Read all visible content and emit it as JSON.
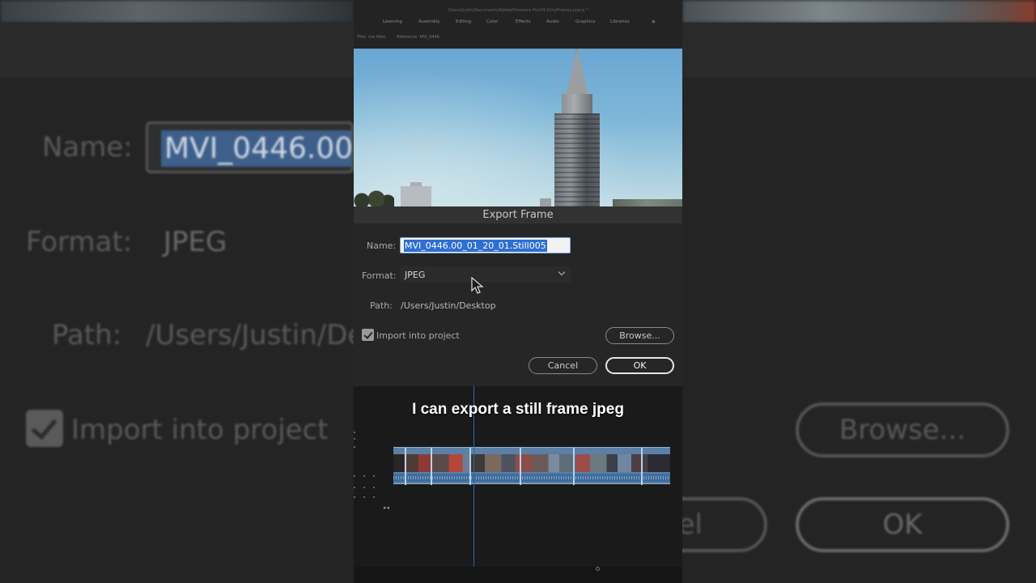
{
  "app": {
    "file_path": "/Users/Justin/Documents/Adobe/Premiere Pro/24.0/myFrames.prproj *",
    "workspaces": [
      "Learning",
      "Assembly",
      "Editing",
      "Color",
      "Effects",
      "Audio",
      "Graphics",
      "Libraries"
    ],
    "more_icon": "double-chevron-right-icon",
    "more_glyph": "»",
    "monitor_title": "Title: (no title)",
    "monitor_reference": "Reference: MVI_0446"
  },
  "dialog": {
    "title": "Export Frame",
    "name_label": "Name:",
    "name_value": "MVI_0446.00_01_20_01.Still005",
    "format_label": "Format:",
    "format_value": "JPEG",
    "path_label": "Path:",
    "path_value": "/Users/Justin/Desktop",
    "import_checked": true,
    "import_label": "Import into project",
    "browse_label": "Browse...",
    "cancel_label": "Cancel",
    "ok_label": "OK"
  },
  "caption": "I can export a still frame jpeg",
  "background": {
    "name_label": "Name:",
    "name_value": "MVI_0446.00_",
    "format_label": "Format:",
    "format_value": "JPEG",
    "path_label": "Path:",
    "path_value": "/Users/Justin/De",
    "import_label": "Import into project",
    "browse_label": "Browse...",
    "cancel_fragment": "el",
    "ok_label": "OK"
  },
  "colors": {
    "accent_selection": "#2f6ed3",
    "clip_blue": "#5b7fa6",
    "playhead": "#2a6aa8"
  }
}
